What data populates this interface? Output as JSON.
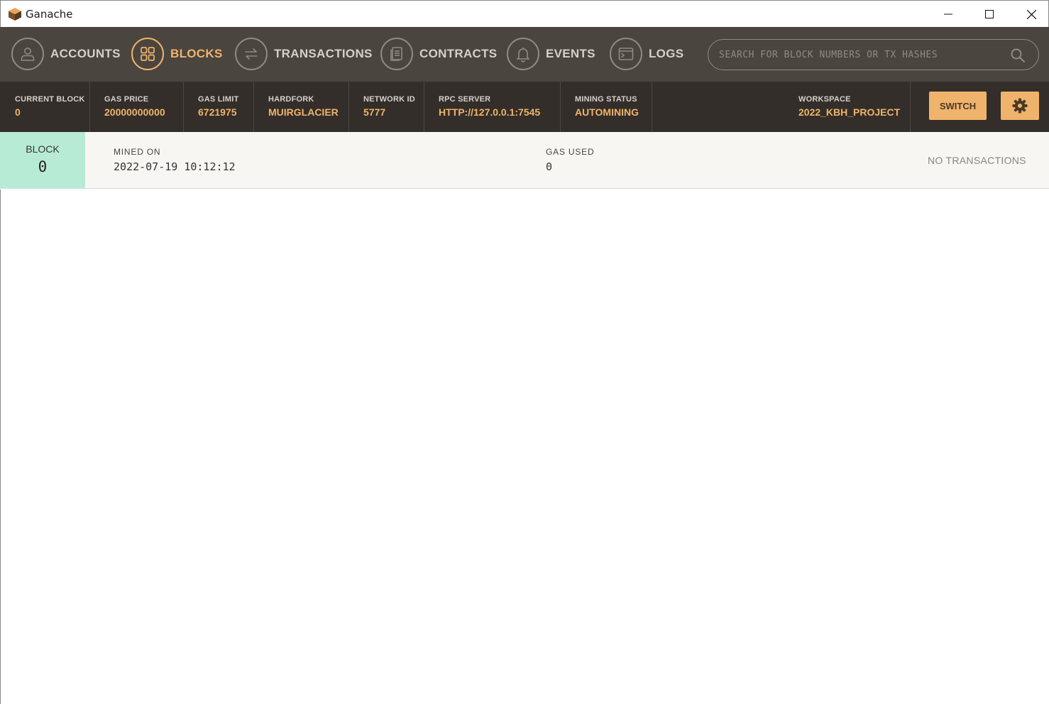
{
  "window": {
    "title": "Ganache"
  },
  "nav": {
    "items": [
      {
        "label": "ACCOUNTS"
      },
      {
        "label": "BLOCKS"
      },
      {
        "label": "TRANSACTIONS"
      },
      {
        "label": "CONTRACTS"
      },
      {
        "label": "EVENTS"
      },
      {
        "label": "LOGS"
      }
    ],
    "active": "BLOCKS",
    "search": {
      "placeholder": "SEARCH FOR BLOCK NUMBERS OR TX HASHES",
      "value": ""
    }
  },
  "status": {
    "current_block": {
      "label": "CURRENT BLOCK",
      "value": "0"
    },
    "gas_price": {
      "label": "GAS PRICE",
      "value": "20000000000"
    },
    "gas_limit": {
      "label": "GAS LIMIT",
      "value": "6721975"
    },
    "hardfork": {
      "label": "HARDFORK",
      "value": "MUIRGLACIER"
    },
    "network_id": {
      "label": "NETWORK ID",
      "value": "5777"
    },
    "rpc_server": {
      "label": "RPC SERVER",
      "value": "HTTP://127.0.0.1:7545"
    },
    "mining_status": {
      "label": "MINING STATUS",
      "value": "AUTOMINING"
    },
    "workspace": {
      "label": "WORKSPACE",
      "value": "2022_KBH_PROJECT"
    },
    "switch_label": "SWITCH"
  },
  "blocks": [
    {
      "badge_label": "BLOCK",
      "number": "0",
      "mined_on_label": "MINED ON",
      "mined_on": "2022-07-19 10:12:12",
      "gas_used_label": "GAS USED",
      "gas_used": "0",
      "tx_status": "NO TRANSACTIONS"
    }
  ],
  "colors": {
    "accent": "#f0b36c",
    "nav_bg": "#4a453f",
    "status_bg": "#332e2a",
    "block_badge": "#b8ebd6"
  }
}
